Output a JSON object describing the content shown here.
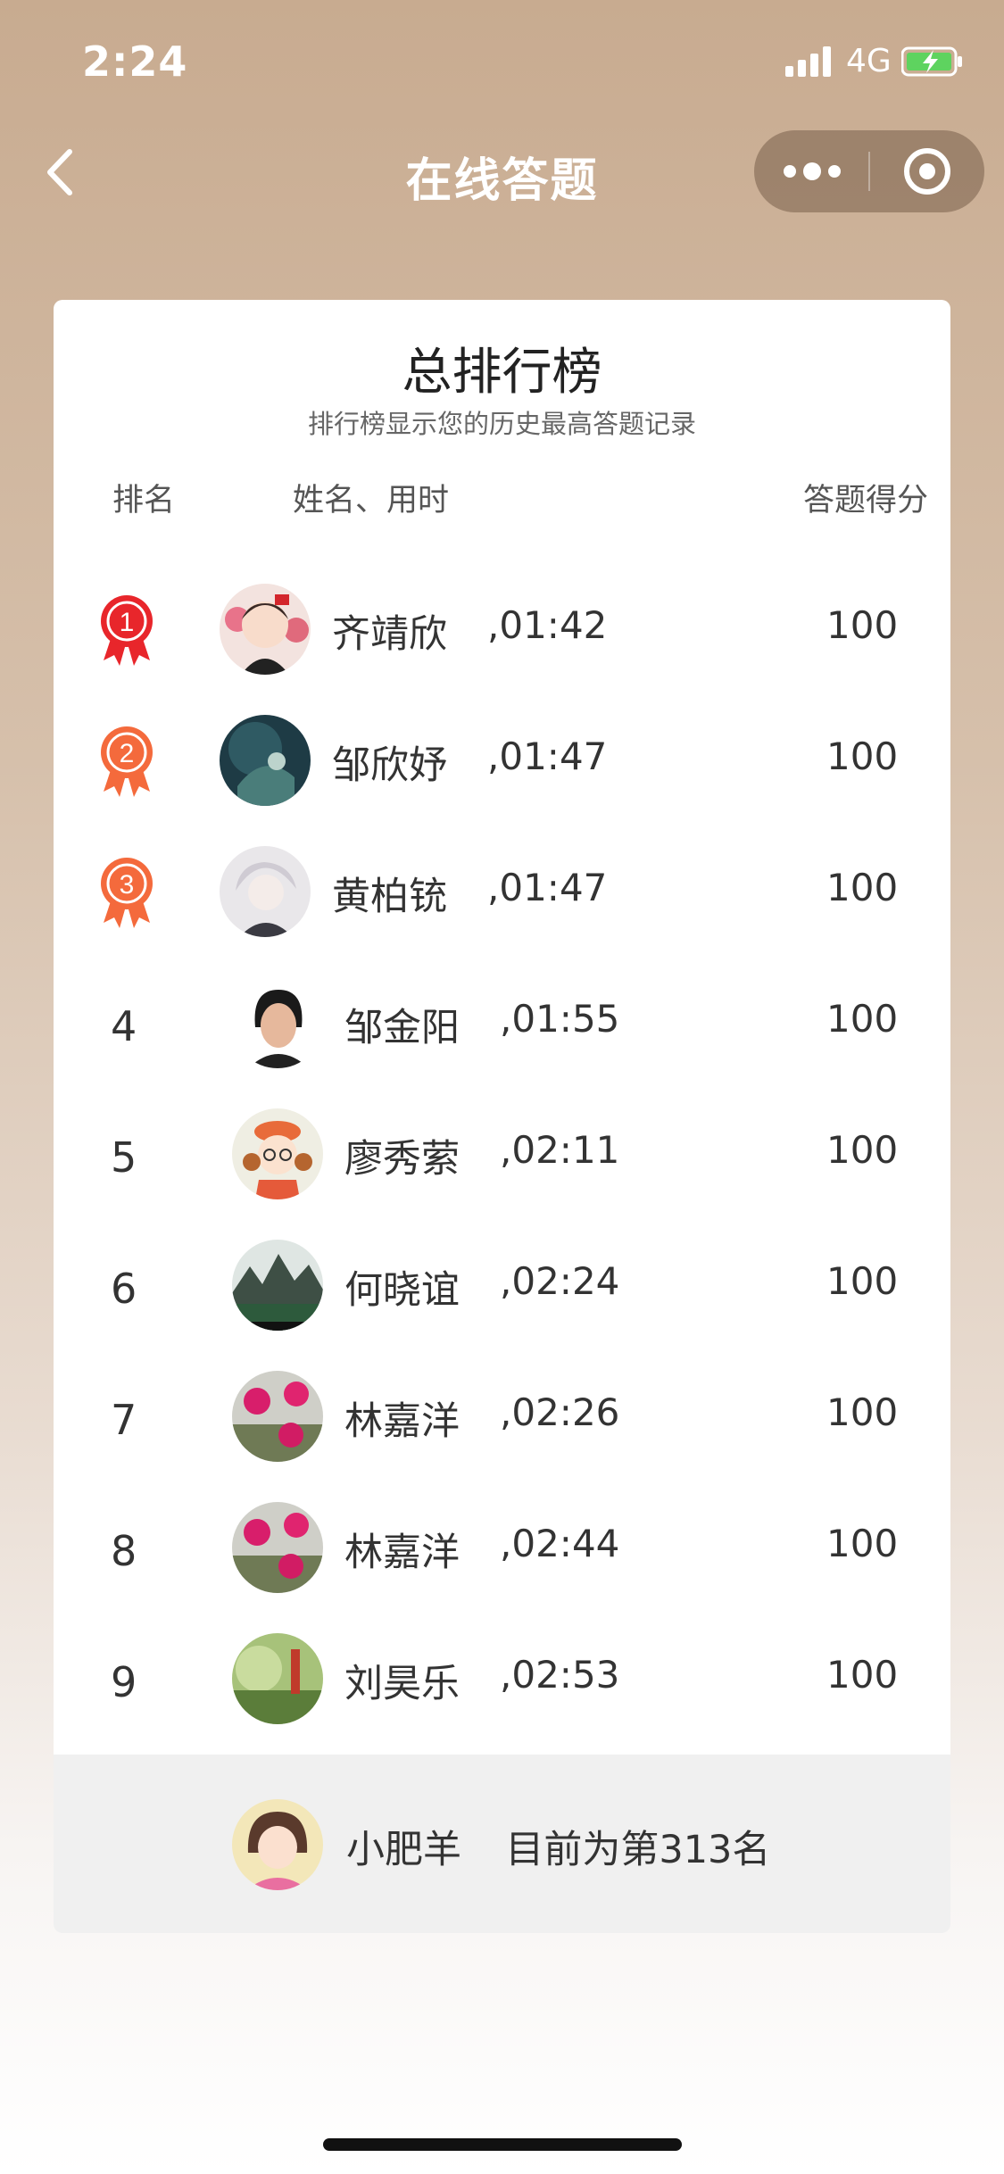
{
  "status_bar": {
    "time": "2:24",
    "network": "4G"
  },
  "nav": {
    "title": "在线答题"
  },
  "board": {
    "title": "总排行榜",
    "subtitle": "排行榜显示您的历史最高答题记录",
    "columns": {
      "rank": "排名",
      "name_time": "姓名、用时",
      "score": "答题得分"
    },
    "rows": [
      {
        "rank": "1",
        "medal": true,
        "name": "齐靖欣",
        "time": ",01:42",
        "score": "100"
      },
      {
        "rank": "2",
        "medal": true,
        "name": "邹欣妤",
        "time": ",01:47",
        "score": "100"
      },
      {
        "rank": "3",
        "medal": true,
        "name": "黄柏铳",
        "time": ",01:47",
        "score": "100"
      },
      {
        "rank": "4",
        "medal": false,
        "name": "邹金阳",
        "time": ",01:55",
        "score": "100"
      },
      {
        "rank": "5",
        "medal": false,
        "name": "廖秀萦",
        "time": ",02:11",
        "score": "100"
      },
      {
        "rank": "6",
        "medal": false,
        "name": "何晓谊",
        "time": ",02:24",
        "score": "100"
      },
      {
        "rank": "7",
        "medal": false,
        "name": "林嘉洋",
        "time": ",02:26",
        "score": "100"
      },
      {
        "rank": "8",
        "medal": false,
        "name": "林嘉洋",
        "time": ",02:44",
        "score": "100"
      },
      {
        "rank": "9",
        "medal": false,
        "name": "刘昊乐",
        "time": ",02:53",
        "score": "100"
      }
    ],
    "me": {
      "name": "小肥羊",
      "status": "目前为第313名"
    }
  },
  "colors": {
    "medal_gold": "#e8262b",
    "medal_orange": "#f46a3c",
    "card_bg": "#ffffff",
    "footer_bg": "#f0f0f0"
  }
}
